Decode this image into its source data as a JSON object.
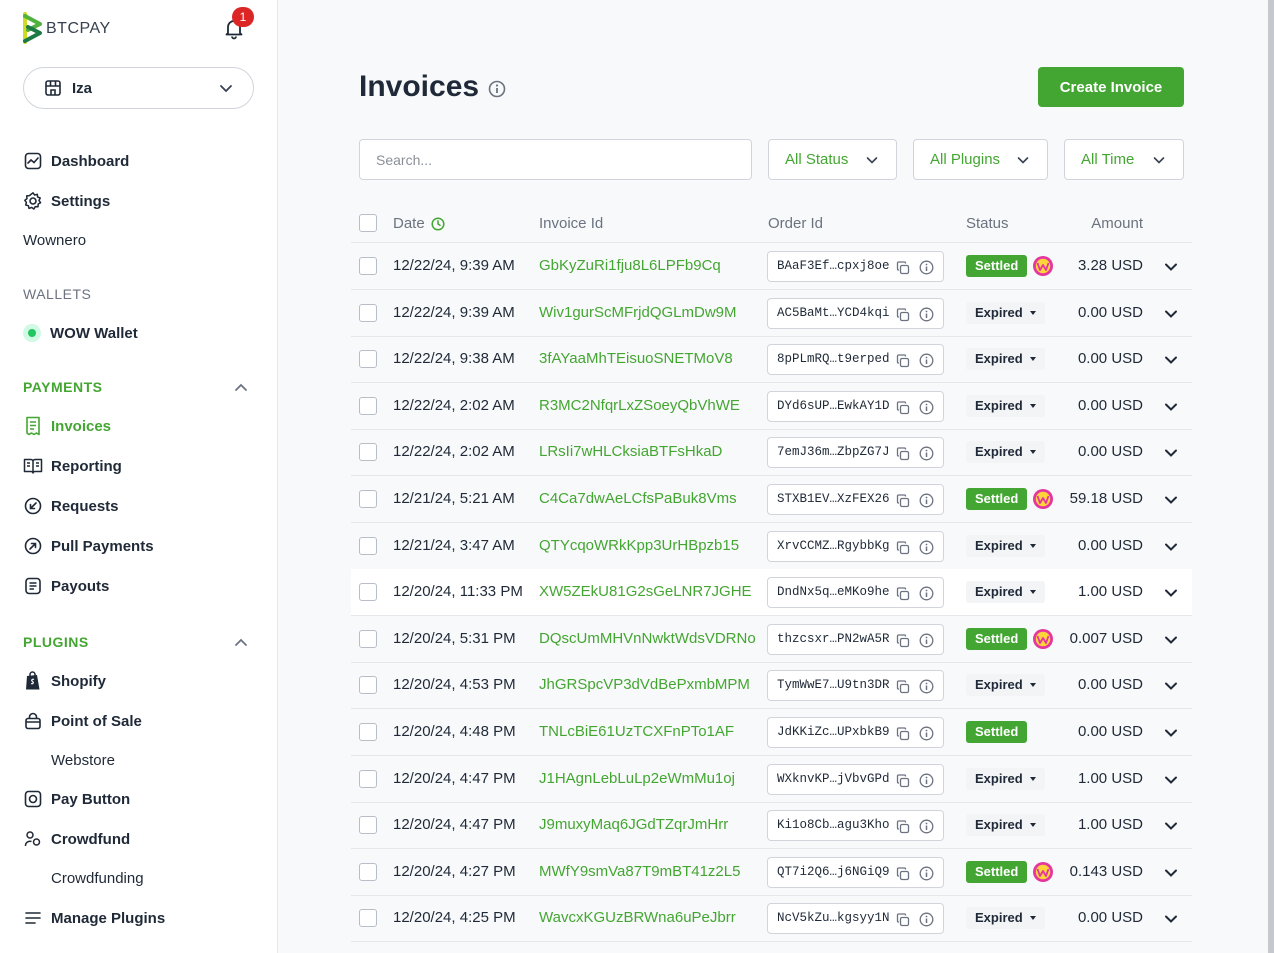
{
  "brand": {
    "name": "BTCPAY",
    "notifications_count": "1"
  },
  "store": {
    "name": "Iza"
  },
  "nav": {
    "dashboard": "Dashboard",
    "settings": "Settings",
    "wownero": "Wownero",
    "wallets_label": "WALLETS",
    "wow_wallet": "WOW Wallet",
    "payments_label": "PAYMENTS",
    "invoices": "Invoices",
    "reporting": "Reporting",
    "requests": "Requests",
    "pull_payments": "Pull Payments",
    "payouts": "Payouts",
    "plugins_label": "PLUGINS",
    "shopify": "Shopify",
    "point_of_sale": "Point of Sale",
    "webstore": "Webstore",
    "pay_button": "Pay Button",
    "crowdfund": "Crowdfund",
    "crowdfunding": "Crowdfunding",
    "manage_plugins": "Manage Plugins"
  },
  "main": {
    "title": "Invoices",
    "create_button": "Create Invoice",
    "search_placeholder": "Search...",
    "filters": {
      "status": "All Status",
      "plugins": "All Plugins",
      "time": "All Time"
    }
  },
  "table": {
    "headers": {
      "date": "Date",
      "invoice_id": "Invoice Id",
      "order_id": "Order Id",
      "status": "Status",
      "amount": "Amount"
    },
    "rows": [
      {
        "date": "12/22/24, 9:39 AM",
        "invoice_id": "GbKyZuRi1fju8L6LPFb9Cq",
        "order_id": "BAaF3Ef…cpxj8oe",
        "status": "Settled",
        "wow": true,
        "amount": "3.28 USD"
      },
      {
        "date": "12/22/24, 9:39 AM",
        "invoice_id": "Wiv1gurScMFrjdQGLmDw9M",
        "order_id": "AC5BaMt…YCD4kqi",
        "status": "Expired",
        "wow": false,
        "amount": "0.00 USD"
      },
      {
        "date": "12/22/24, 9:38 AM",
        "invoice_id": "3fAYaaMhTEisuoSNETMoV8",
        "order_id": "8pPLmRQ…t9erped",
        "status": "Expired",
        "wow": false,
        "amount": "0.00 USD"
      },
      {
        "date": "12/22/24, 2:02 AM",
        "invoice_id": "R3MC2NfqrLxZSoeyQbVhWE",
        "order_id": "DYd6sUP…EwkAY1D",
        "status": "Expired",
        "wow": false,
        "amount": "0.00 USD"
      },
      {
        "date": "12/22/24, 2:02 AM",
        "invoice_id": "LRsIi7wHLCksiaBTFsHkaD",
        "order_id": "7emJ36m…ZbpZG7J",
        "status": "Expired",
        "wow": false,
        "amount": "0.00 USD"
      },
      {
        "date": "12/21/24, 5:21 AM",
        "invoice_id": "C4Ca7dwAeLCfsPaBuk8Vms",
        "order_id": "STXB1EV…XzFEX26",
        "status": "Settled",
        "wow": true,
        "amount": "59.18 USD"
      },
      {
        "date": "12/21/24, 3:47 AM",
        "invoice_id": "QTYcqoWRkKpp3UrHBpzb15",
        "order_id": "XrvCCMZ…RgybbKg",
        "status": "Expired",
        "wow": false,
        "amount": "0.00 USD"
      },
      {
        "date": "12/20/24, 11:33 PM",
        "invoice_id": "XW5ZEkU81G2sGeLNR7JGHE",
        "order_id": "DndNx5q…eMKo9he",
        "status": "Expired",
        "wow": false,
        "amount": "1.00 USD"
      },
      {
        "date": "12/20/24, 5:31 PM",
        "invoice_id": "DQscUmMHVnNwktWdsVDRNo",
        "order_id": "thzcsxr…PN2wA5R",
        "status": "Settled",
        "wow": true,
        "amount": "0.007 USD"
      },
      {
        "date": "12/20/24, 4:53 PM",
        "invoice_id": "JhGRSpcVP3dVdBePxmbMPM",
        "order_id": "TymWwE7…U9tn3DR",
        "status": "Expired",
        "wow": false,
        "amount": "0.00 USD"
      },
      {
        "date": "12/20/24, 4:48 PM",
        "invoice_id": "TNLcBiE61UzTCXFnPTo1AF",
        "order_id": "JdKKiZc…UPxbkB9",
        "status": "Settled",
        "wow": false,
        "amount": "0.00 USD"
      },
      {
        "date": "12/20/24, 4:47 PM",
        "invoice_id": "J1HAgnLebLuLp2eWmMu1oj",
        "order_id": "WXknvKP…jVbvGPd",
        "status": "Expired",
        "wow": false,
        "amount": "1.00 USD"
      },
      {
        "date": "12/20/24, 4:47 PM",
        "invoice_id": "J9muxyMaq6JGdTZqrJmHrr",
        "order_id": "Ki1o8Cb…agu3Kho",
        "status": "Expired",
        "wow": false,
        "amount": "1.00 USD"
      },
      {
        "date": "12/20/24, 4:27 PM",
        "invoice_id": "MWfY9smVa87T9mBT41z2L5",
        "order_id": "QT7i2Q6…j6NGiQ9",
        "status": "Settled",
        "wow": true,
        "amount": "0.143 USD"
      },
      {
        "date": "12/20/24, 4:25 PM",
        "invoice_id": "WavcxKGUzBRWna6uPeJbrr",
        "order_id": "NcV5kZu…kgsyy1N",
        "status": "Expired",
        "wow": false,
        "amount": "0.00 USD"
      }
    ]
  },
  "colors": {
    "accent": "#44a632",
    "badge_red": "#dc2626",
    "wow_pink": "#e4369f"
  },
  "icons": [
    "btcpay-logo",
    "bell-icon",
    "store-icon",
    "chevron-down-icon",
    "dashboard-icon",
    "gear-icon",
    "wallet-status-dot",
    "chevron-up-icon",
    "receipt-icon",
    "book-icon",
    "arrow-down-left-icon",
    "arrow-up-right-icon",
    "document-icon",
    "shopify-icon",
    "lock-bag-icon",
    "pay-button-icon",
    "crowdfund-icon",
    "list-icon",
    "info-icon",
    "clock-icon",
    "copy-icon",
    "wownero-icon"
  ]
}
